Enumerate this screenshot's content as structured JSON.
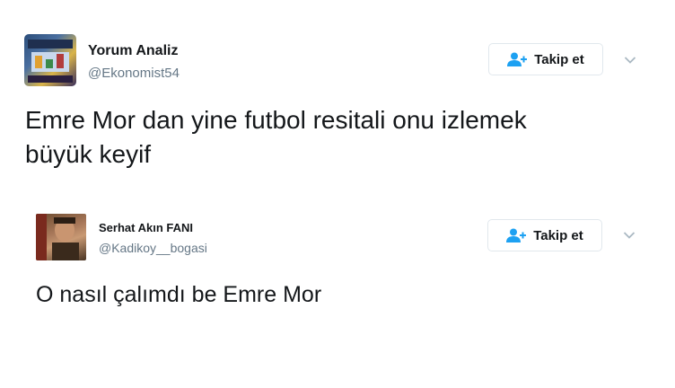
{
  "tweets": [
    {
      "author_name": "Yorum Analiz",
      "author_handle": "@Ekonomist54",
      "follow_label": "Takip et",
      "text_line1": "Emre Mor dan yine futbol resitali onu izlemek",
      "text_line2": "büyük keyif"
    },
    {
      "author_name": "Serhat Akın FANI",
      "author_handle": "@Kadikoy__bogasi",
      "follow_label": "Takip et",
      "text_line1": "O nasıl çalımdı be Emre Mor"
    }
  ],
  "colors": {
    "accent": "#1da1f2",
    "text": "#14171a",
    "secondary": "#657786",
    "border": "#e1e8ed"
  },
  "icons": {
    "follow": "person-plus-icon",
    "more": "chevron-down-icon"
  }
}
